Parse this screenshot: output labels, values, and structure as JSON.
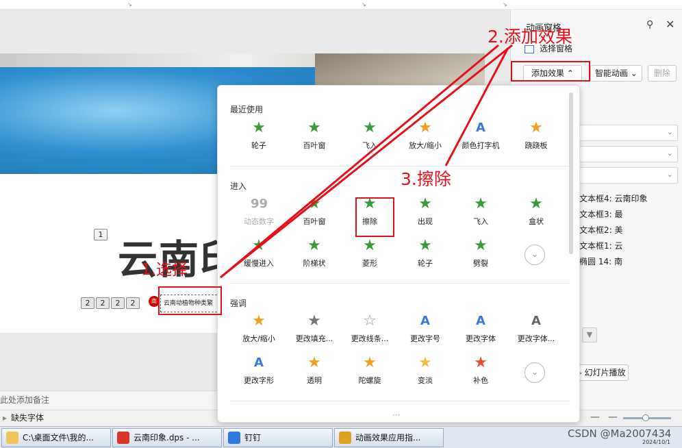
{
  "canvas": {
    "slide_number": "1",
    "title_visible": "云南印",
    "tags": [
      "2",
      "2",
      "2",
      "2"
    ],
    "red_glyph": "南",
    "textbox_text": "云南动植物种类繁"
  },
  "notes_placeholder": "此处添加备注",
  "status": {
    "missing_font": "缺失字体"
  },
  "panel": {
    "title": "动画窗格",
    "select_pane": "选择窗格",
    "add_effect": "添加效果",
    "smart_anim": "智能动画",
    "delete": "删除",
    "anim_list": [
      "文本框4: 云南印象",
      "文本框3: 最",
      "文本框2: 美",
      "文本框1: 云",
      "椭圆 14: 南"
    ],
    "play_button": "幻灯片播放"
  },
  "popup": {
    "recent_label": "最近使用",
    "recent": [
      {
        "label": "轮子",
        "icon": "star-green-icon",
        "color": "#3a9a3a"
      },
      {
        "label": "百叶窗",
        "icon": "star-green-icon",
        "color": "#3a9a3a"
      },
      {
        "label": "飞入",
        "icon": "star-green-icon",
        "color": "#3a9a3a"
      },
      {
        "label": "放大/缩小",
        "icon": "star-yellow-icon",
        "color": "#f0a020"
      },
      {
        "label": "颜色打字机",
        "icon": "letter-a-icon",
        "color": "#3a7ad0"
      },
      {
        "label": "跷跷板",
        "icon": "star-yellow-icon",
        "color": "#f0a020"
      }
    ],
    "enter_label": "进入",
    "enter": [
      {
        "label": "动态数字",
        "icon": "number-99-icon",
        "color": "#aaaaaa",
        "dim": true
      },
      {
        "label": "百叶窗",
        "icon": "star-green-icon",
        "color": "#3a9a3a"
      },
      {
        "label": "擦除",
        "icon": "star-green-icon",
        "color": "#3a9a3a"
      },
      {
        "label": "出现",
        "icon": "star-green-icon",
        "color": "#3a9a3a"
      },
      {
        "label": "飞入",
        "icon": "star-green-icon",
        "color": "#3a9a3a"
      },
      {
        "label": "盒状",
        "icon": "star-green-icon",
        "color": "#3a9a3a"
      },
      {
        "label": "缓慢进入",
        "icon": "star-green-icon",
        "color": "#3a9a3a"
      },
      {
        "label": "阶梯状",
        "icon": "star-green-icon",
        "color": "#3a9a3a"
      },
      {
        "label": "菱形",
        "icon": "star-green-icon",
        "color": "#3a9a3a"
      },
      {
        "label": "轮子",
        "icon": "star-green-icon",
        "color": "#3a9a3a"
      },
      {
        "label": "劈裂",
        "icon": "star-green-icon",
        "color": "#3a9a3a"
      }
    ],
    "emph_label": "强调",
    "emph": [
      {
        "label": "放大/缩小",
        "icon": "star-yellow-icon",
        "color": "#f0a020"
      },
      {
        "label": "更改填充...",
        "icon": "star-gray-icon",
        "color": "#777777"
      },
      {
        "label": "更改线条...",
        "icon": "star-outline-icon",
        "color": "#999999"
      },
      {
        "label": "更改字号",
        "icon": "letter-a-icon",
        "color": "#3a7ad0"
      },
      {
        "label": "更改字体",
        "icon": "letter-a-icon",
        "color": "#3a7ad0"
      },
      {
        "label": "更改字体...",
        "icon": "letter-a-icon",
        "color": "#666666"
      },
      {
        "label": "更改字形",
        "icon": "letter-a-icon",
        "color": "#3a7ad0"
      },
      {
        "label": "透明",
        "icon": "star-yellow-icon",
        "color": "#f0a020"
      },
      {
        "label": "陀螺旋",
        "icon": "star-yellow-icon",
        "color": "#f0a020"
      },
      {
        "label": "变淡",
        "icon": "star-yellow-icon",
        "color": "#f0c040"
      },
      {
        "label": "补色",
        "icon": "star-red-icon",
        "color": "#e05030"
      }
    ],
    "more_dots": "···"
  },
  "annotations": {
    "step1": "1.选择",
    "step2": "2.添加效果",
    "step3": "3.擦除",
    "color": "#e5101a"
  },
  "taskbar": [
    {
      "label": "C:\\桌面文件\\我的...",
      "color": "#f2c55b"
    },
    {
      "label": "云南印象.dps - ...",
      "color": "#d9352b"
    },
    {
      "label": "钉钉",
      "color": "#2a7ae2"
    },
    {
      "label": "动画效果应用指...",
      "color": "#e0a020"
    }
  ],
  "tray": {
    "date": "2024/10/1"
  },
  "watermark": "CSDN @Ma2007434"
}
